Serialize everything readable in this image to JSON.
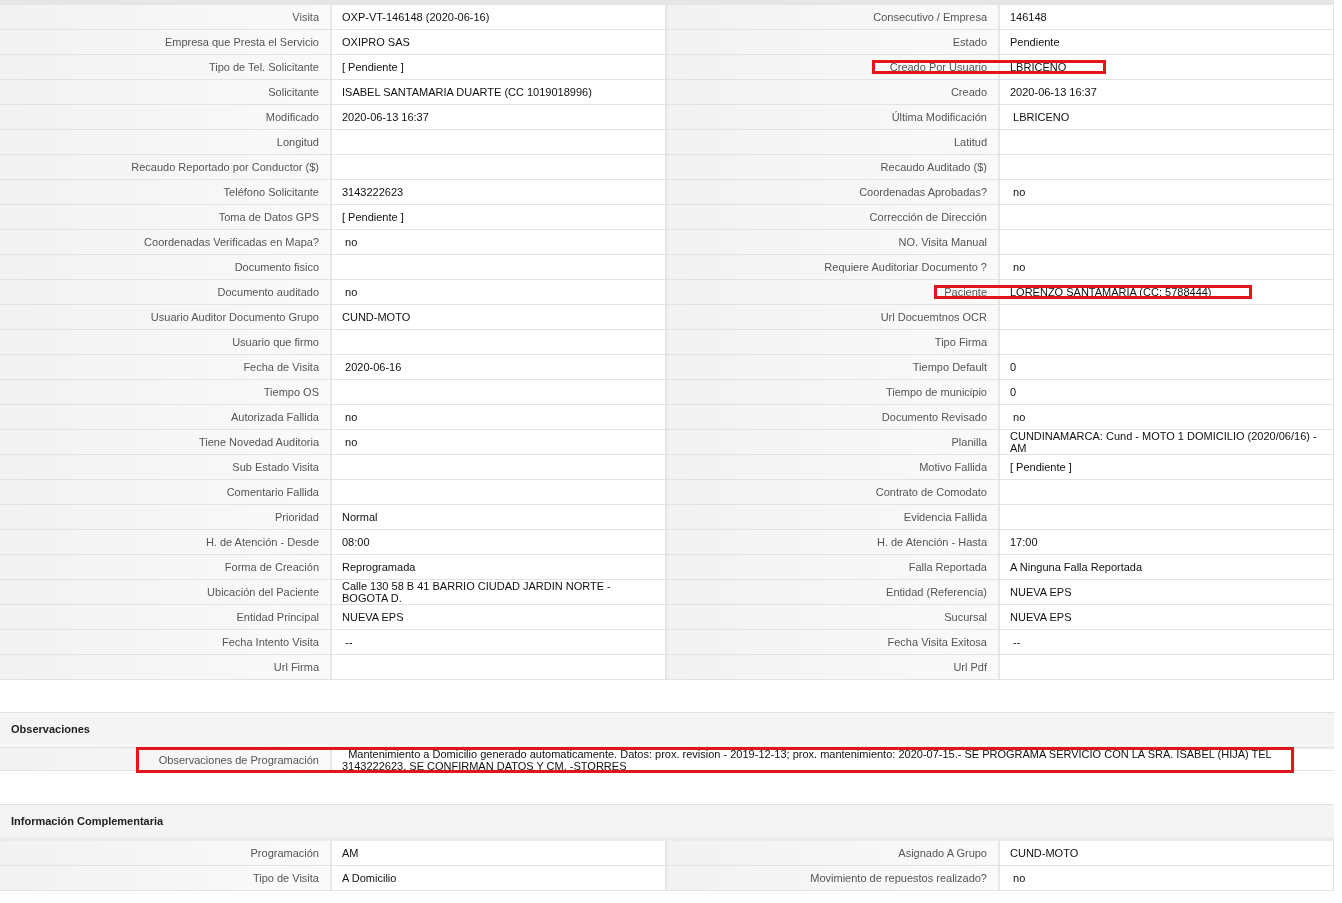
{
  "details": {
    "rows": [
      {
        "left": {
          "label": "Visita",
          "value": "OXP-VT-146148 (2020-06-16)",
          "highlighted": false
        },
        "right": {
          "label": "Consecutivo / Empresa",
          "value": "146148",
          "highlighted": false
        }
      },
      {
        "left": {
          "label": "Empresa que Presta el Servicio",
          "value": "OXIPRO SAS",
          "highlighted": false
        },
        "right": {
          "label": "Estado",
          "value": "Pendiente",
          "highlighted": false
        }
      },
      {
        "left": {
          "label": "Tipo de Tel. Solicitante",
          "value": "[ Pendiente ]",
          "highlighted": false
        },
        "right": {
          "label": "Creado Por Usuario",
          "value": "LBRICENO",
          "highlighted": true
        }
      },
      {
        "left": {
          "label": "Solicitante",
          "value": "ISABEL SANTAMARIA DUARTE (CC 1019018996)",
          "highlighted": false
        },
        "right": {
          "label": "Creado",
          "value": "2020-06-13 16:37",
          "highlighted": false
        }
      },
      {
        "left": {
          "label": "Modificado",
          "value": "2020-06-13 16:37",
          "highlighted": false
        },
        "right": {
          "label": "Última Modificación",
          "value": " LBRICENO",
          "highlighted": false
        }
      },
      {
        "left": {
          "label": "Longitud",
          "highlighted": false
        },
        "right": {
          "label": "Latitud",
          "highlighted": false
        }
      },
      {
        "left": {
          "label": "Recaudo Reportado por Conductor ($)",
          "highlighted": false
        },
        "right": {
          "label": "Recaudo Auditado ($)",
          "highlighted": false
        }
      },
      {
        "left": {
          "label": "Teléfono Solicitante",
          "value": "3143222623",
          "highlighted": false
        },
        "right": {
          "label": "Coordenadas Aprobadas?",
          "value": " no",
          "highlighted": false
        }
      },
      {
        "left": {
          "label": "Toma de Datos GPS",
          "value": "[ Pendiente ]",
          "highlighted": false
        },
        "right": {
          "label": "Corrección de Dirección",
          "highlighted": false
        }
      },
      {
        "left": {
          "label": "Coordenadas Verificadas en Mapa?",
          "value": " no",
          "highlighted": false
        },
        "right": {
          "label": "NO. Visita Manual",
          "highlighted": false
        }
      },
      {
        "left": {
          "label": "Documento fisico",
          "highlighted": false
        },
        "right": {
          "label": "Requiere Auditoriar Documento ?",
          "value": " no",
          "highlighted": false
        }
      },
      {
        "left": {
          "label": "Documento auditado",
          "value": " no",
          "highlighted": false
        },
        "right": {
          "label": "Paciente",
          "value": "LORENZO SANTAMARIA (CC: 5788444)",
          "highlighted": true
        }
      },
      {
        "left": {
          "label": "Usuario Auditor Documento Grupo",
          "value": "CUND-MOTO",
          "highlighted": false
        },
        "right": {
          "label": "Url Docuemtnos OCR",
          "highlighted": false
        }
      },
      {
        "left": {
          "label": "Usuario que firmo",
          "highlighted": false
        },
        "right": {
          "label": "Tipo Firma",
          "highlighted": false
        }
      },
      {
        "left": {
          "label": "Fecha de Visita",
          "value": " 2020-06-16",
          "highlighted": false
        },
        "right": {
          "label": "Tiempo Default",
          "value": "0",
          "highlighted": false
        }
      },
      {
        "left": {
          "label": "Tiempo OS",
          "highlighted": false
        },
        "right": {
          "label": "Tiempo de municipio",
          "value": "0",
          "highlighted": false
        }
      },
      {
        "left": {
          "label": "Autorizada Fallida",
          "value": " no",
          "highlighted": false
        },
        "right": {
          "label": "Documento Revisado",
          "value": " no",
          "highlighted": false
        }
      },
      {
        "left": {
          "label": "Tiene Novedad Auditoria",
          "value": " no",
          "highlighted": false
        },
        "right": {
          "label": "Planilla",
          "value": "CUNDINAMARCA: Cund - MOTO 1 DOMICILIO (2020/06/16) - AM",
          "highlighted": false
        }
      },
      {
        "left": {
          "label": "Sub Estado Visita",
          "highlighted": false
        },
        "right": {
          "label": "Motivo Fallida",
          "value": "[ Pendiente ]",
          "highlighted": false
        }
      },
      {
        "left": {
          "label": "Comentario Fallida",
          "highlighted": false
        },
        "right": {
          "label": "Contrato de Comodato",
          "highlighted": false
        }
      },
      {
        "left": {
          "label": "Prioridad",
          "value": "Normal",
          "highlighted": false
        },
        "right": {
          "label": "Evidencia Fallida",
          "highlighted": false
        }
      },
      {
        "left": {
          "label": "H. de Atención - Desde",
          "value": "08:00",
          "highlighted": false
        },
        "right": {
          "label": "H. de Atención - Hasta",
          "value": "17:00",
          "highlighted": false
        }
      },
      {
        "left": {
          "label": "Forma de Creación",
          "value": "Reprogramada",
          "highlighted": false
        },
        "right": {
          "label": "Falla Reportada",
          "value": "A Ninguna Falla Reportada",
          "highlighted": false
        }
      },
      {
        "left": {
          "label": "Ubicación del Paciente",
          "value": "Calle 130 58 B 41 BARRIO CIUDAD JARDIN NORTE - BOGOTA D.",
          "highlighted": false
        },
        "right": {
          "label": "Entidad (Referencia)",
          "value": "NUEVA EPS",
          "highlighted": false
        }
      },
      {
        "left": {
          "label": "Entidad Principal",
          "value": "NUEVA EPS",
          "highlighted": false
        },
        "right": {
          "label": "Sucursal",
          "value": "NUEVA EPS",
          "highlighted": false
        }
      },
      {
        "left": {
          "label": "Fecha Intento Visita",
          "value": " --",
          "highlighted": false
        },
        "right": {
          "label": "Fecha Visita Exitosa",
          "value": " --",
          "highlighted": false
        }
      },
      {
        "left": {
          "label": "Url Firma",
          "highlighted": false
        },
        "right": {
          "label": "Url Pdf",
          "highlighted": false
        }
      }
    ]
  },
  "observaciones": {
    "title": "Observaciones",
    "label": "Observaciones de Programación",
    "value": "  Mantenimiento a Domicilio generado automaticamente. Datos: prox. revision - 2019-12-13; prox. mantenimiento: 2020-07-15.- SE PROGRAMA SERVICIO CON LA SRA. ISABEL (HIJA) TEL 3143222623. SE CONFIRMAN DATOS Y CM. -STORRES",
    "highlighted": true
  },
  "complementaria": {
    "title": "Información Complementaria",
    "rows": [
      {
        "left": {
          "label": "Programación",
          "value": "AM",
          "highlighted": false
        },
        "right": {
          "label": "Asignado A Grupo",
          "value": "CUND-MOTO",
          "highlighted": false
        }
      },
      {
        "left": {
          "label": "Tipo de Visita",
          "value": "A Domicilio",
          "highlighted": false
        },
        "right": {
          "label": "Movimiento de repuestos realizado?",
          "value": " no",
          "highlighted": false
        }
      }
    ]
  }
}
